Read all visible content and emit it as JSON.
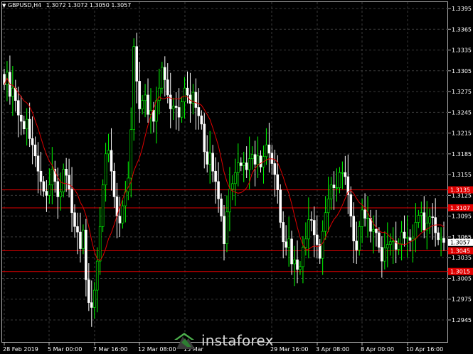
{
  "header": {
    "symbol": "GBPUSD,H4",
    "ohlc": "1.3072 1.3072 1.3050 1.3057"
  },
  "watermark": {
    "text": "instaforex"
  },
  "colors": {
    "background": "#000000",
    "bull": "#00ff00",
    "bear": "#ffffff",
    "ma": "#e00000",
    "level_line": "#e00000",
    "level_tag": "#e00000",
    "grid": "#3a3a3a",
    "axis_text": "#ffffff",
    "price_tag": "#ffffff"
  },
  "chart_data": {
    "type": "candlestick",
    "y_ticks": [
      "1.3395",
      "1.3365",
      "1.3335",
      "1.3305",
      "1.3275",
      "1.3245",
      "1.3215",
      "1.3185",
      "1.3155",
      "1.3125",
      "1.3095",
      "1.3065",
      "1.3035",
      "1.3005",
      "1.2975",
      "1.2945"
    ],
    "ylim": [
      1.2945,
      1.3395
    ],
    "x_ticks": [
      "28 Feb 2019",
      "5 Mar 00:00",
      "7 Mar 16:00",
      "12 Mar 08:00",
      "15 Mar",
      "29 Mar 16:00",
      "3 Apr 08:00",
      "8 Apr 00:00",
      "10 Apr 16:00"
    ],
    "levels": [
      {
        "label": "1.3135",
        "value": 1.3133
      },
      {
        "label": "1.3107",
        "value": 1.3107
      },
      {
        "label": "1.3045",
        "value": 1.3045
      },
      {
        "label": "1.3015",
        "value": 1.3015
      }
    ],
    "current_price": {
      "label": "1.3057",
      "value": 1.3057
    },
    "close": [
      1.3285,
      1.3303,
      1.3268,
      1.328,
      1.3262,
      1.3241,
      1.3232,
      1.3221,
      1.3235,
      1.3207,
      1.3198,
      1.3182,
      1.316,
      1.3145,
      1.3131,
      1.3125,
      1.314,
      1.3163,
      1.3145,
      1.3123,
      1.313,
      1.3163,
      1.3154,
      1.3134,
      1.31,
      1.308,
      1.3072,
      1.3048,
      1.3075,
      1.3003,
      1.297,
      1.2963,
      1.2988,
      1.303,
      1.308,
      1.314,
      1.3185,
      1.319,
      1.316,
      1.3123,
      1.3095,
      1.3085,
      1.311,
      1.313,
      1.315,
      1.322,
      1.334,
      1.329,
      1.325,
      1.3262,
      1.327,
      1.3242,
      1.3248,
      1.3232,
      1.3262,
      1.328,
      1.331,
      1.3292,
      1.327,
      1.325,
      1.3254,
      1.3252,
      1.3238,
      1.326,
      1.328,
      1.327,
      1.3258,
      1.3274,
      1.3252,
      1.324,
      1.3228,
      1.3188,
      1.317,
      1.3186,
      1.316,
      1.3145,
      1.312,
      1.3095,
      1.3055,
      1.3101,
      1.3134,
      1.3142,
      1.3158,
      1.3172,
      1.3168,
      1.3172,
      1.3162,
      1.3178,
      1.3184,
      1.317,
      1.3182,
      1.3166,
      1.3181,
      1.3198,
      1.3186,
      1.3171,
      1.3155,
      1.3133,
      1.3086,
      1.3058,
      1.305,
      1.3062,
      1.3026,
      1.3032,
      1.3018,
      1.3022,
      1.305,
      1.3062,
      1.309,
      1.3089,
      1.3068,
      1.3054,
      1.3034,
      1.3073,
      1.31,
      1.312,
      1.314,
      1.3136,
      1.3136,
      1.3158,
      1.3158,
      1.3152,
      1.3126,
      1.3095,
      1.3059,
      1.3046,
      1.308,
      1.3104,
      1.3092,
      1.3092,
      1.3073,
      1.3076,
      1.3071,
      1.305,
      1.303,
      1.3049,
      1.3054,
      1.3058,
      1.3059,
      1.3047,
      1.3055,
      1.3072,
      1.3063,
      1.3064,
      1.306,
      1.3063,
      1.3086,
      1.3096,
      1.31,
      1.3075,
      1.3085,
      1.3094,
      1.3093,
      1.3071,
      1.3061,
      1.3063,
      1.3057
    ]
  }
}
